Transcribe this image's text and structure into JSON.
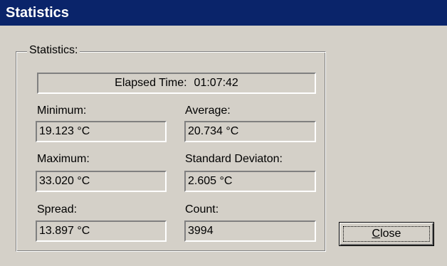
{
  "window": {
    "title": "Statistics"
  },
  "group": {
    "label": "Statistics:"
  },
  "elapsed": {
    "label": "Elapsed Time:",
    "value": "01:07:42"
  },
  "stats": {
    "minimum": {
      "label": "Minimum:",
      "value": "19.123 °C"
    },
    "average": {
      "label": "Average:",
      "value": "20.734 °C"
    },
    "maximum": {
      "label": "Maximum:",
      "value": "33.020 °C"
    },
    "std_dev": {
      "label": "Standard Deviaton:",
      "value": "2.605 °C"
    },
    "spread": {
      "label": "Spread:",
      "value": "13.897 °C"
    },
    "count": {
      "label": "Count:",
      "value": "3994"
    }
  },
  "buttons": {
    "close_mnemonic": "C",
    "close_rest": "lose"
  },
  "colors": {
    "titlebar": "#0a246a",
    "face": "#d4d0c8"
  }
}
